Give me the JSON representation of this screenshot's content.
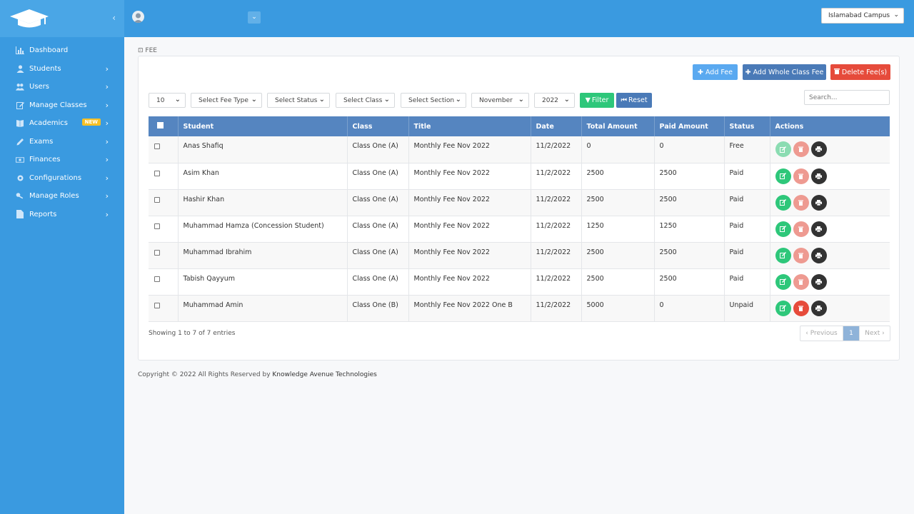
{
  "sidebar": {
    "collapse_icon": "chevron-left-icon",
    "items": [
      {
        "label": "Dashboard",
        "icon": "bar-chart-icon",
        "has_children": false
      },
      {
        "label": "Students",
        "icon": "user-icon",
        "has_children": true
      },
      {
        "label": "Users",
        "icon": "users-icon",
        "has_children": true
      },
      {
        "label": "Manage Classes",
        "icon": "edit-icon",
        "has_children": true
      },
      {
        "label": "Academics",
        "icon": "book-icon",
        "has_children": true,
        "badge": "NEW"
      },
      {
        "label": "Exams",
        "icon": "pencil-icon",
        "has_children": true
      },
      {
        "label": "Finances",
        "icon": "money-icon",
        "has_children": true
      },
      {
        "label": "Configurations",
        "icon": "gear-icon",
        "has_children": true
      },
      {
        "label": "Manage Roles",
        "icon": "key-icon",
        "has_children": true
      },
      {
        "label": "Reports",
        "icon": "file-icon",
        "has_children": true
      }
    ]
  },
  "topbar": {
    "campus": "Islamabad Campus"
  },
  "breadcrumb": "FEE",
  "actions": {
    "add_fee": "Add Fee",
    "add_whole_class_fee": "Add Whole Class Fee",
    "delete_fees": "Delete Fee(s)"
  },
  "filters": {
    "page_size": "10",
    "fee_type": "Select Fee Type",
    "status": "Select Status",
    "class": "Select Class",
    "section": "Select Section",
    "month": "November",
    "year": "2022",
    "filter_label": "Filter",
    "reset_label": "Reset",
    "search_placeholder": "Search..."
  },
  "table": {
    "columns": [
      "Student",
      "Class",
      "Title",
      "Date",
      "Total Amount",
      "Paid Amount",
      "Status",
      "Actions"
    ],
    "rows": [
      {
        "student": "Anas Shafiq",
        "class": "Class One (A)",
        "title": "Monthly Fee Nov 2022",
        "date": "11/2/2022",
        "total": "0",
        "paid": "0",
        "status": "Free"
      },
      {
        "student": "Asim Khan",
        "class": "Class One (A)",
        "title": "Monthly Fee Nov 2022",
        "date": "11/2/2022",
        "total": "2500",
        "paid": "2500",
        "status": "Paid"
      },
      {
        "student": "Hashir Khan",
        "class": "Class One (A)",
        "title": "Monthly Fee Nov 2022",
        "date": "11/2/2022",
        "total": "2500",
        "paid": "2500",
        "status": "Paid"
      },
      {
        "student": "Muhammad Hamza (Concession Student)",
        "class": "Class One (A)",
        "title": "Monthly Fee Nov 2022",
        "date": "11/2/2022",
        "total": "1250",
        "paid": "1250",
        "status": "Paid"
      },
      {
        "student": "Muhammad Ibrahim",
        "class": "Class One (A)",
        "title": "Monthly Fee Nov 2022",
        "date": "11/2/2022",
        "total": "2500",
        "paid": "2500",
        "status": "Paid"
      },
      {
        "student": "Tabish Qayyum",
        "class": "Class One (A)",
        "title": "Monthly Fee Nov 2022",
        "date": "11/2/2022",
        "total": "2500",
        "paid": "2500",
        "status": "Paid"
      },
      {
        "student": "Muhammad Amin",
        "class": "Class One (B)",
        "title": "Monthly Fee Nov 2022 One B",
        "date": "11/2/2022",
        "total": "5000",
        "paid": "0",
        "status": "Unpaid"
      }
    ]
  },
  "pagination": {
    "info": "Showing 1 to 7 of 7 entries",
    "previous": "‹ Previous",
    "current": "1",
    "next": "Next ›"
  },
  "footer": {
    "text": "Copyright © 2022 All Rights Reserved by",
    "company": "Knowledge Avenue Technologies"
  },
  "colors": {
    "sidebar": "#3a9ae0",
    "header_row": "#5585c0",
    "success": "#2ec77a",
    "danger": "#e64b3b"
  }
}
